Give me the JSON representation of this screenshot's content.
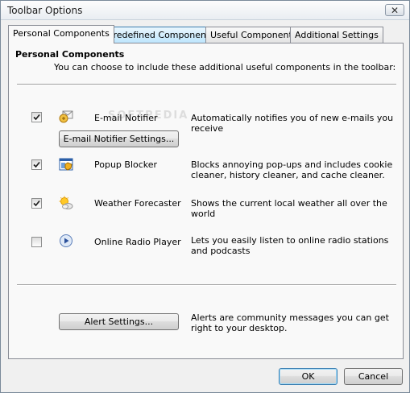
{
  "window": {
    "title": "Toolbar Options",
    "close_label": "✕"
  },
  "tabs": [
    {
      "label": "Personal Components",
      "active": true
    },
    {
      "label": "Predefined Components",
      "active": false
    },
    {
      "label": "Useful Components",
      "active": false
    },
    {
      "label": "Additional Settings",
      "active": false
    }
  ],
  "panel": {
    "title": "Personal Components",
    "subtitle": "You can choose to include these additional useful components in the toolbar:"
  },
  "components": [
    {
      "name": "E-mail Notifier",
      "checked": true,
      "icon": "email-notifier-icon",
      "description": "Automatically notifies you of new e-mails you receive",
      "settings_button": "E-mail Notifier Settings..."
    },
    {
      "name": "Popup Blocker",
      "checked": true,
      "icon": "popup-blocker-icon",
      "description": "Blocks annoying pop-ups and includes cookie cleaner, history cleaner, and cache cleaner."
    },
    {
      "name": "Weather Forecaster",
      "checked": true,
      "icon": "weather-icon",
      "description": "Shows the current local weather all over the world"
    },
    {
      "name": "Online Radio Player",
      "checked": false,
      "icon": "radio-player-icon",
      "description": "Lets you easily listen to online radio stations and podcasts"
    }
  ],
  "alerts": {
    "button": "Alert Settings...",
    "description": "Alerts are community messages you can get right to your desktop."
  },
  "footer": {
    "ok_label": "OK",
    "cancel_label": "Cancel"
  },
  "watermark": "SOFTPEDIA"
}
